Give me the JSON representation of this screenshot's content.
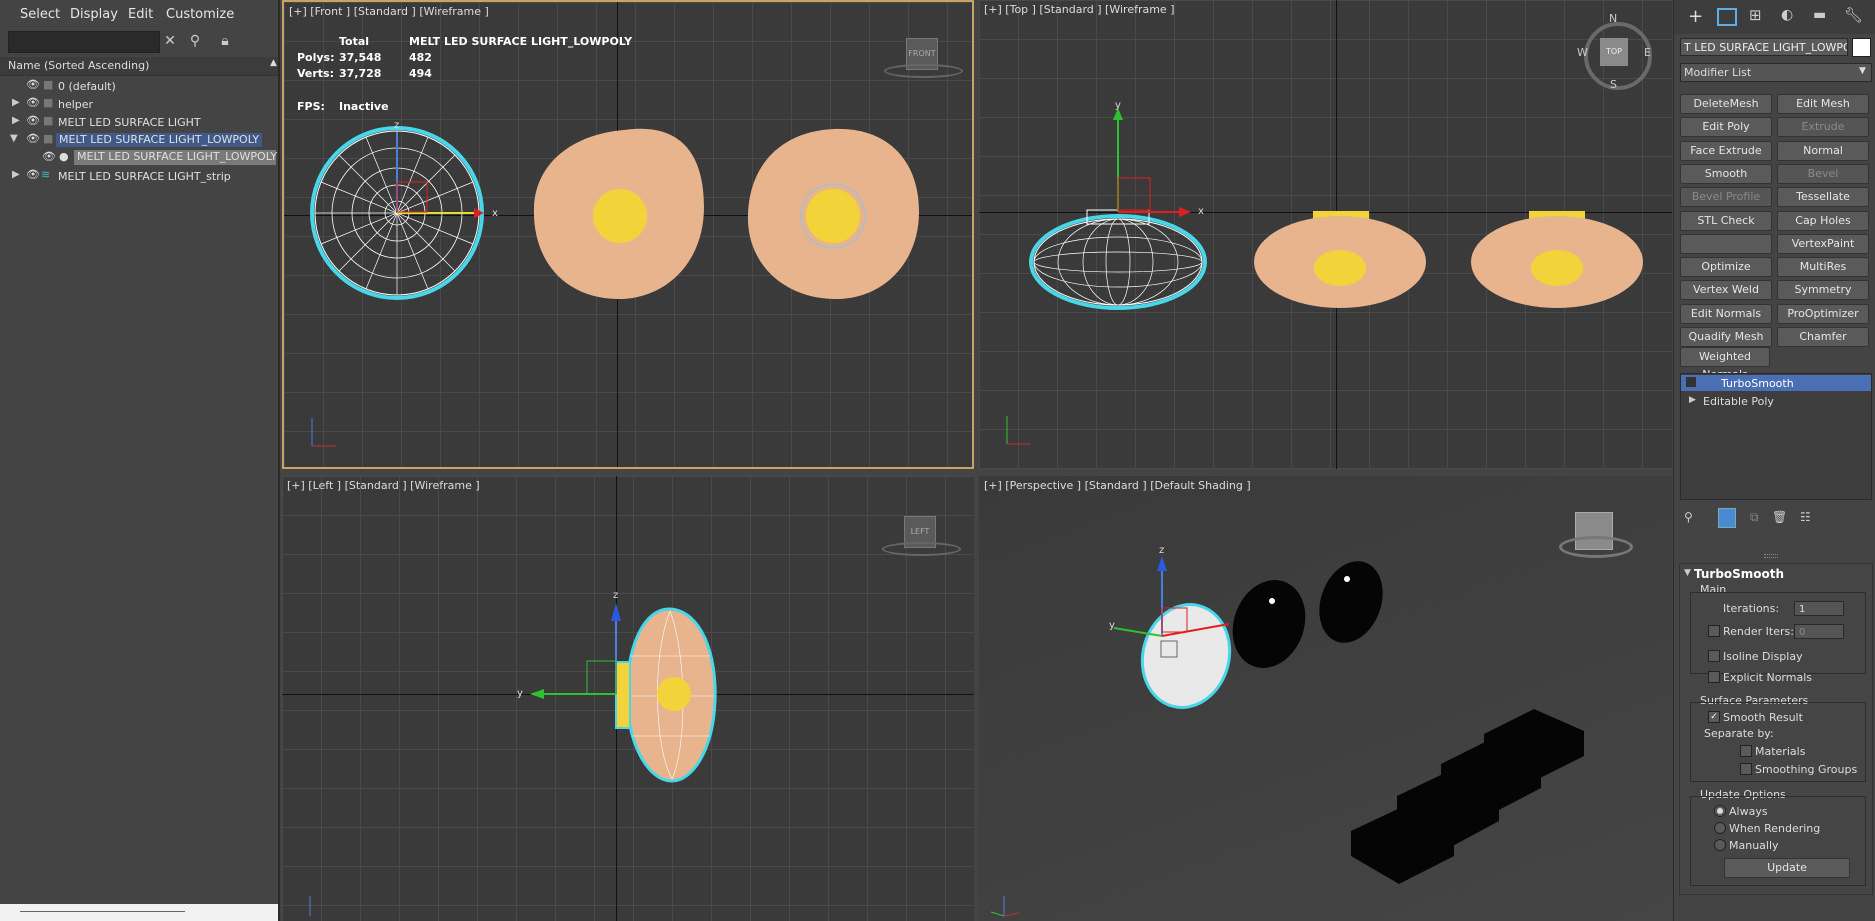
{
  "menu": {
    "select": "Select",
    "display": "Display",
    "edit": "Edit",
    "customize": "Customize"
  },
  "explorer": {
    "column_header": "Name (Sorted Ascending)",
    "rows": [
      {
        "label": "0 (default)"
      },
      {
        "label": "helper"
      },
      {
        "label": "MELT LED SURFACE LIGHT"
      },
      {
        "label": "MELT LED SURFACE LIGHT_LOWPOLY"
      },
      {
        "label": "MELT LED SURFACE LIGHT_LOWPOLY"
      },
      {
        "label": "MELT LED SURFACE LIGHT_strip"
      }
    ]
  },
  "viewports": {
    "front": {
      "label": "[+] [Front ] [Standard ] [Wireframe ]",
      "cube": "FRONT"
    },
    "top": {
      "label": "[+] [Top ] [Standard ] [Wireframe ]",
      "cube": "TOP"
    },
    "left": {
      "label": "[+] [Left ] [Standard ] [Wireframe ]",
      "cube": "LEFT"
    },
    "persp": {
      "label": "[+] [Perspective ] [Standard ] [Default Shading ]"
    }
  },
  "stats": {
    "total_label": "Total",
    "object_label": "MELT LED SURFACE LIGHT_LOWPOLY",
    "polys_label": "Polys:",
    "polys_total": "37,548",
    "polys_obj": "482",
    "verts_label": "Verts:",
    "verts_total": "37,728",
    "verts_obj": "494",
    "fps_label": "FPS:",
    "fps_value": "Inactive"
  },
  "compass": {
    "n": "N",
    "s": "S",
    "w": "W",
    "e": "E"
  },
  "command_panel": {
    "object_name": "T LED SURFACE LIGHT_LOWPOLY",
    "modifier_list": "Modifier List",
    "buttons": [
      {
        "label": "DeleteMesh",
        "enabled": true
      },
      {
        "label": "Edit Mesh",
        "enabled": true
      },
      {
        "label": "Edit Poly",
        "enabled": true
      },
      {
        "label": "Extrude",
        "enabled": false
      },
      {
        "label": "Face Extrude",
        "enabled": true
      },
      {
        "label": "Normal",
        "enabled": true
      },
      {
        "label": "Smooth",
        "enabled": true
      },
      {
        "label": "Bevel",
        "enabled": false
      },
      {
        "label": "Bevel Profile",
        "enabled": false
      },
      {
        "label": "Tessellate",
        "enabled": true
      },
      {
        "label": "STL Check",
        "enabled": true
      },
      {
        "label": "Cap Holes",
        "enabled": true
      },
      {
        "label": "",
        "enabled": true
      },
      {
        "label": "VertexPaint",
        "enabled": true
      },
      {
        "label": "Optimize",
        "enabled": true
      },
      {
        "label": "MultiRes",
        "enabled": true
      },
      {
        "label": "Vertex Weld",
        "enabled": true
      },
      {
        "label": "Symmetry",
        "enabled": true
      },
      {
        "label": "Edit Normals",
        "enabled": true
      },
      {
        "label": "ProOptimizer",
        "enabled": true
      },
      {
        "label": "Quadify Mesh",
        "enabled": true
      },
      {
        "label": "Chamfer",
        "enabled": true
      }
    ],
    "weighted_normals": "Weighted Normals",
    "stack": [
      {
        "label": "TurboSmooth"
      },
      {
        "label": "Editable Poly"
      }
    ],
    "rollout": {
      "title": "TurboSmooth",
      "main": "Main",
      "iterations_label": "Iterations:",
      "iterations_value": "1",
      "render_iters_label": "Render Iters:",
      "render_iters_value": "0",
      "isoline": "Isoline Display",
      "explicit": "Explicit Normals",
      "surface_params": "Surface Parameters",
      "smooth_result": "Smooth Result",
      "separate_by": "Separate by:",
      "materials": "Materials",
      "smoothing_groups": "Smoothing Groups",
      "update_options": "Update Options",
      "always": "Always",
      "when_rendering": "When Rendering",
      "manually": "Manually",
      "update_button": "Update"
    }
  },
  "colors": {
    "selection": "#48d6e8",
    "flesh": "#e8b48e",
    "yellow": "#f2d43a",
    "highlight": "#4a6fb5"
  }
}
